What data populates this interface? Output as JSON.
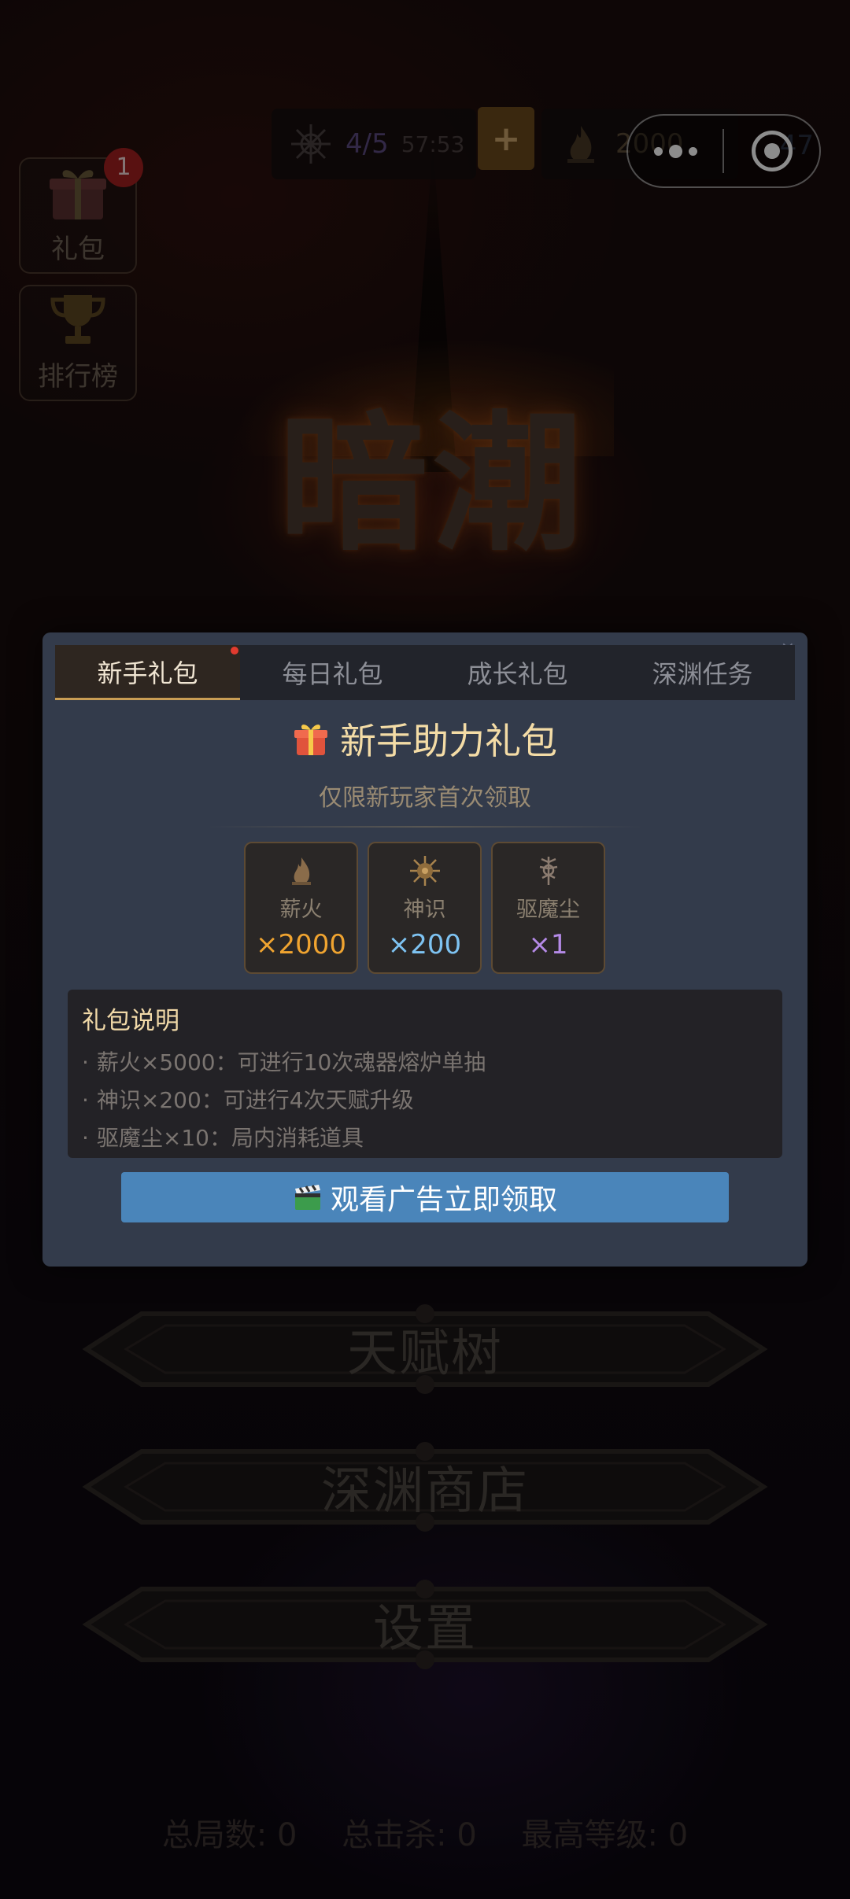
{
  "resources": {
    "stamina": "4/5",
    "timer": "57:53",
    "plus_label": "+",
    "fire": "2000",
    "third_value": "47"
  },
  "side": {
    "gift_label": "礼包",
    "gift_badge": "1",
    "rank_label": "排行榜"
  },
  "logo": {
    "text": "暗潮"
  },
  "menu": {
    "talent": "天赋树",
    "shop": "深渊商店",
    "settings": "设置"
  },
  "stats": {
    "total_games": "总局数: 0",
    "total_kills": "总击杀: 0",
    "max_level": "最高等级: 0"
  },
  "modal": {
    "close_glyph": "×",
    "tabs": [
      {
        "label": "新手礼包"
      },
      {
        "label": "每日礼包"
      },
      {
        "label": "成长礼包"
      },
      {
        "label": "深渊任务"
      }
    ],
    "title": "新手助力礼包",
    "subtitle": "仅限新玩家首次领取",
    "items": [
      {
        "name": "薪火",
        "qty": "×2000",
        "color": "#f0a430"
      },
      {
        "name": "神识",
        "qty": "×200",
        "color": "#7ec3f2"
      },
      {
        "name": "驱魔尘",
        "qty": "×1",
        "color": "#b48ae6"
      }
    ],
    "desc_title": "礼包说明",
    "desc_lines": [
      "薪火×5000：可进行10次魂器熔炉单抽",
      "神识×200：可进行4次天赋升级",
      "驱魔尘×10：局内消耗道具"
    ],
    "bullet": "·",
    "ad_button": "观看广告立即领取"
  },
  "colors": {
    "modal_bg": "#333b4b",
    "accent_gold": "#f4dca6",
    "ad_button": "#4a85ba"
  }
}
